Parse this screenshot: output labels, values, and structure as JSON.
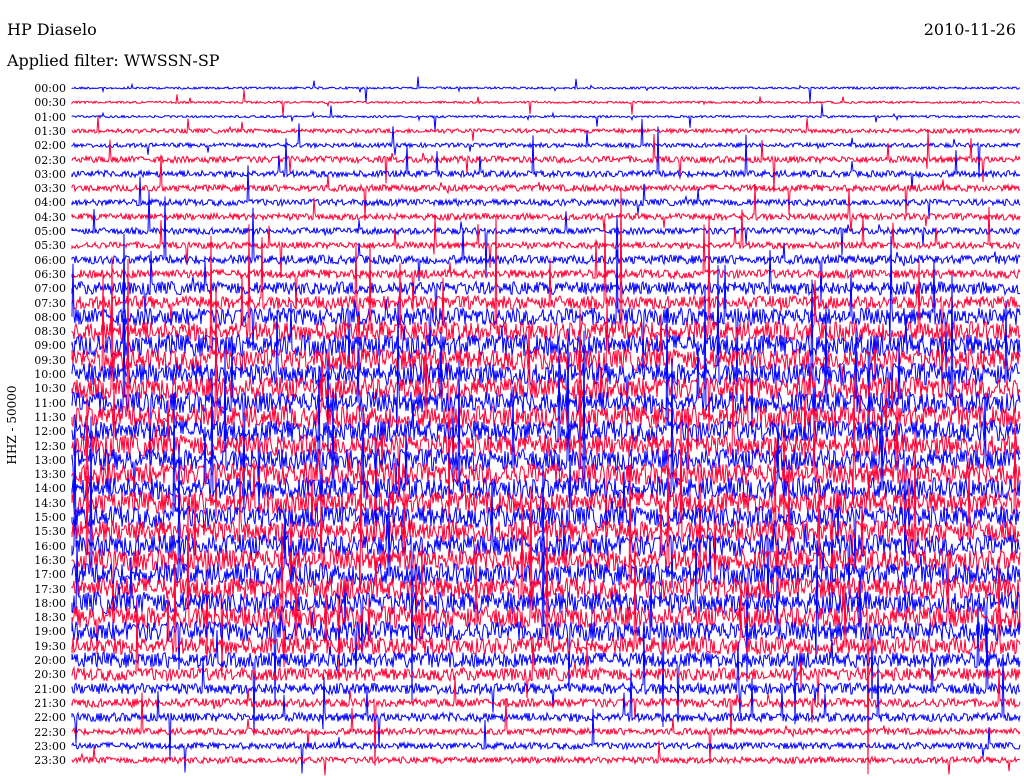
{
  "header": {
    "station": "HP Diaselo",
    "filter": "Applied filter: WWSSN-SP",
    "date": "2010-11-26"
  },
  "chart_data": {
    "type": "line",
    "title": "HP Diaselo",
    "subtitle": "Applied filter: WWSSN-SP",
    "ylabel": "HHZ - 50000",
    "date": "2010-11-26",
    "row_labels": [
      "00:00",
      "00:30",
      "01:00",
      "01:30",
      "02:00",
      "02:30",
      "03:00",
      "03:30",
      "04:00",
      "04:30",
      "05:00",
      "05:30",
      "06:00",
      "06:30",
      "07:00",
      "07:30",
      "08:00",
      "08:30",
      "09:00",
      "09:30",
      "10:00",
      "10:30",
      "11:00",
      "11:30",
      "12:00",
      "12:30",
      "13:00",
      "13:30",
      "14:00",
      "14:30",
      "15:00",
      "15:30",
      "16:00",
      "16:30",
      "17:00",
      "17:30",
      "18:00",
      "18:30",
      "19:00",
      "19:30",
      "20:00",
      "20:30",
      "21:00",
      "21:30",
      "22:00",
      "22:30",
      "23:00",
      "23:30"
    ],
    "series_colors": [
      "#0000ff",
      "#ff0033"
    ],
    "relative_amplitude": [
      1,
      1,
      1,
      2,
      2,
      3,
      3,
      3,
      3,
      3,
      3,
      3,
      4,
      4,
      6,
      6,
      8,
      9,
      10,
      10,
      10,
      10,
      10,
      10,
      10,
      10,
      10,
      10,
      10,
      10,
      10,
      10,
      10,
      10,
      10,
      10,
      10,
      10,
      9,
      8,
      7,
      6,
      5,
      4,
      4,
      3,
      3,
      3
    ],
    "grid": false
  }
}
